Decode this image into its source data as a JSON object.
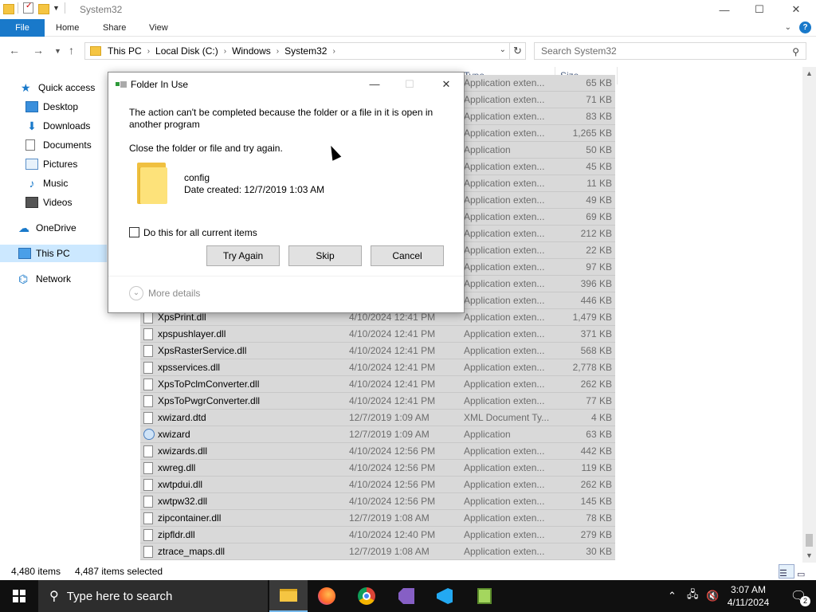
{
  "window": {
    "title": "System32",
    "minimize": "—",
    "maximize": "☐",
    "close": "✕"
  },
  "ribbon": {
    "tabs": [
      "File",
      "Home",
      "Share",
      "View"
    ]
  },
  "address": {
    "crumbs": [
      "This PC",
      "Local Disk (C:)",
      "Windows",
      "System32"
    ],
    "search_placeholder": "Search System32"
  },
  "sidebar": {
    "items": [
      {
        "label": "Quick access",
        "icon": "star-icon"
      },
      {
        "label": "Desktop",
        "icon": "desktop-icon"
      },
      {
        "label": "Downloads",
        "icon": "download-icon"
      },
      {
        "label": "Documents",
        "icon": "document-icon"
      },
      {
        "label": "Pictures",
        "icon": "pictures-icon"
      },
      {
        "label": "Music",
        "icon": "music-icon"
      },
      {
        "label": "Videos",
        "icon": "videos-icon"
      },
      {
        "label": "OneDrive",
        "icon": "cloud-icon"
      },
      {
        "label": "This PC",
        "icon": "computer-icon"
      },
      {
        "label": "Network",
        "icon": "network-icon"
      }
    ]
  },
  "columns": {
    "type": "Type",
    "size": "Size"
  },
  "files": [
    {
      "name": "",
      "date": "",
      "type": "Application exten...",
      "size": "65 KB"
    },
    {
      "name": "",
      "date": "",
      "type": "Application exten...",
      "size": "71 KB"
    },
    {
      "name": "",
      "date": "",
      "type": "Application exten...",
      "size": "83 KB"
    },
    {
      "name": "",
      "date": "",
      "type": "Application exten...",
      "size": "1,265 KB"
    },
    {
      "name": "",
      "date": "",
      "type": "Application",
      "size": "50 KB"
    },
    {
      "name": "",
      "date": "",
      "type": "Application exten...",
      "size": "45 KB"
    },
    {
      "name": "",
      "date": "",
      "type": "Application exten...",
      "size": "11 KB"
    },
    {
      "name": "",
      "date": "",
      "type": "Application exten...",
      "size": "49 KB"
    },
    {
      "name": "",
      "date": "",
      "type": "Application exten...",
      "size": "69 KB"
    },
    {
      "name": "",
      "date": "",
      "type": "Application exten...",
      "size": "212 KB"
    },
    {
      "name": "",
      "date": "",
      "type": "Application exten...",
      "size": "22 KB"
    },
    {
      "name": "",
      "date": "",
      "type": "Application exten...",
      "size": "97 KB"
    },
    {
      "name": "",
      "date": "",
      "type": "Application exten...",
      "size": "396 KB"
    },
    {
      "name": "",
      "date": "",
      "type": "Application exten...",
      "size": "446 KB"
    },
    {
      "name": "XpsPrint.dll",
      "date": "4/10/2024 12:41 PM",
      "type": "Application exten...",
      "size": "1,479 KB"
    },
    {
      "name": "xpspushlayer.dll",
      "date": "4/10/2024 12:41 PM",
      "type": "Application exten...",
      "size": "371 KB"
    },
    {
      "name": "XpsRasterService.dll",
      "date": "4/10/2024 12:41 PM",
      "type": "Application exten...",
      "size": "568 KB"
    },
    {
      "name": "xpsservices.dll",
      "date": "4/10/2024 12:41 PM",
      "type": "Application exten...",
      "size": "2,778 KB"
    },
    {
      "name": "XpsToPclmConverter.dll",
      "date": "4/10/2024 12:41 PM",
      "type": "Application exten...",
      "size": "262 KB"
    },
    {
      "name": "XpsToPwgrConverter.dll",
      "date": "4/10/2024 12:41 PM",
      "type": "Application exten...",
      "size": "77 KB"
    },
    {
      "name": "xwizard.dtd",
      "date": "12/7/2019 1:09 AM",
      "type": "XML Document Ty...",
      "size": "4 KB"
    },
    {
      "name": "xwizard",
      "date": "12/7/2019 1:09 AM",
      "type": "Application",
      "size": "63 KB"
    },
    {
      "name": "xwizards.dll",
      "date": "4/10/2024 12:56 PM",
      "type": "Application exten...",
      "size": "442 KB"
    },
    {
      "name": "xwreg.dll",
      "date": "4/10/2024 12:56 PM",
      "type": "Application exten...",
      "size": "119 KB"
    },
    {
      "name": "xwtpdui.dll",
      "date": "4/10/2024 12:56 PM",
      "type": "Application exten...",
      "size": "262 KB"
    },
    {
      "name": "xwtpw32.dll",
      "date": "4/10/2024 12:56 PM",
      "type": "Application exten...",
      "size": "145 KB"
    },
    {
      "name": "zipcontainer.dll",
      "date": "12/7/2019 1:08 AM",
      "type": "Application exten...",
      "size": "78 KB"
    },
    {
      "name": "zipfldr.dll",
      "date": "4/10/2024 12:40 PM",
      "type": "Application exten...",
      "size": "279 KB"
    },
    {
      "name": "ztrace_maps.dll",
      "date": "12/7/2019 1:08 AM",
      "type": "Application exten...",
      "size": "30 KB"
    }
  ],
  "status": {
    "items": "4,480 items",
    "selected": "4,487 items selected"
  },
  "dialog": {
    "title": "Folder In Use",
    "message": "The action can't be completed because the folder or a file in it is open in another program",
    "instruction": "Close the folder or file and try again.",
    "file_name": "config",
    "file_date": "Date created: 12/7/2019 1:03 AM",
    "checkbox_label": "Do this for all current items",
    "try_again": "Try Again",
    "skip": "Skip",
    "cancel": "Cancel",
    "more_details": "More details"
  },
  "taskbar": {
    "search_text": "Type here to search",
    "time": "3:07 AM",
    "date": "4/11/2024",
    "notification_count": "2"
  }
}
